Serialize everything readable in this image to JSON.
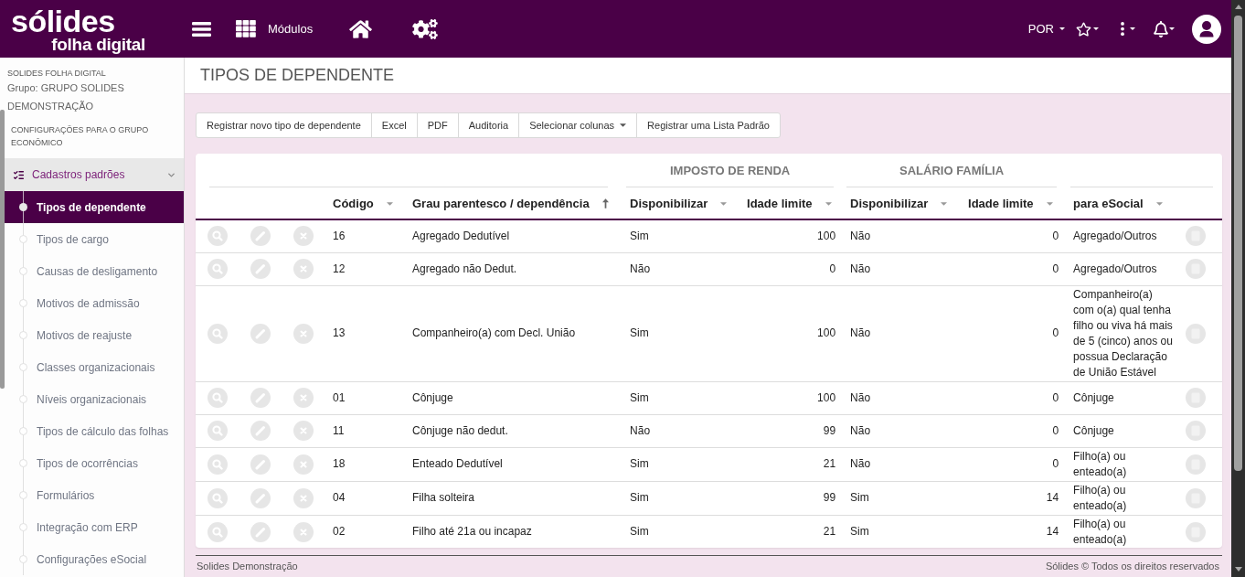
{
  "header": {
    "logo": {
      "brand": "sólides",
      "product": "folha digital"
    },
    "modules_label": "Módulos",
    "language": "POR"
  },
  "sidebar": {
    "app_name": "SOLIDES FOLHA DIGITAL",
    "group": "Grupo: GRUPO SOLIDES DEMONSTRAÇÃO",
    "section_link": "CONFIGURAÇÕES PARA O GRUPO ECONÔMICO",
    "menu": {
      "label": "Cadastros padrões",
      "expanded": true,
      "children": [
        {
          "label": "Tipos de dependente",
          "selected": true
        },
        {
          "label": "Tipos de cargo",
          "selected": false
        },
        {
          "label": "Causas de desligamento",
          "selected": false
        },
        {
          "label": "Motivos de admissão",
          "selected": false
        },
        {
          "label": "Motivos de reajuste",
          "selected": false
        },
        {
          "label": "Classes organizacionais",
          "selected": false
        },
        {
          "label": "Níveis organizacionais",
          "selected": false
        },
        {
          "label": "Tipos de cálculo das folhas",
          "selected": false
        },
        {
          "label": "Tipos de ocorrências",
          "selected": false
        },
        {
          "label": "Formulários",
          "selected": false
        },
        {
          "label": "Integração com ERP",
          "selected": false
        },
        {
          "label": "Configurações eSocial",
          "selected": false
        }
      ]
    }
  },
  "page": {
    "title": "TIPOS DE DEPENDENTE"
  },
  "toolbar": [
    {
      "label": "Registrar novo tipo de dependente",
      "dropdown": false
    },
    {
      "label": "Excel",
      "dropdown": false
    },
    {
      "label": "PDF",
      "dropdown": false
    },
    {
      "label": "Auditoria",
      "dropdown": false
    },
    {
      "label": "Selecionar colunas",
      "dropdown": true
    },
    {
      "label": "Registrar uma Lista Padrão",
      "dropdown": false
    }
  ],
  "table": {
    "header": [
      {
        "kind": "column",
        "label": "Código",
        "sorted": false
      },
      {
        "kind": "column",
        "label": "Grau parentesco / dependência",
        "sorted": true
      },
      {
        "kind": "group",
        "label": "IMPOSTO DE RENDA",
        "columns": [
          {
            "label": "Disponibilizar",
            "sorted": false
          },
          {
            "label": "Idade limite",
            "sorted": false
          }
        ]
      },
      {
        "kind": "group",
        "label": "SALÁRIO FAMÍLIA",
        "columns": [
          {
            "label": "Disponibilizar",
            "sorted": false
          },
          {
            "label": "Idade limite",
            "sorted": false
          }
        ]
      },
      {
        "kind": "column",
        "label": "para eSocial",
        "sorted": false
      }
    ],
    "rows": [
      {
        "cells": [
          "16",
          "Agregado Dedutível",
          "Sim",
          "100",
          "Não",
          "0",
          "Agregado/Outros"
        ]
      },
      {
        "cells": [
          "12",
          "Agregado não Dedut.",
          "Não",
          "0",
          "Não",
          "0",
          "Agregado/Outros"
        ]
      },
      {
        "cells": [
          "13",
          "Companheiro(a) com Decl. União",
          "Sim",
          "100",
          "Não",
          "0",
          "Companheiro(a) com o(a) qual tenha filho ou viva há mais de 5 (cinco) anos ou possua Declaração de União Estável"
        ]
      },
      {
        "cells": [
          "01",
          "Cônjuge",
          "Sim",
          "100",
          "Não",
          "0",
          "Cônjuge"
        ]
      },
      {
        "cells": [
          "11",
          "Cônjuge não dedut.",
          "Não",
          "99",
          "Não",
          "0",
          "Cônjuge"
        ]
      },
      {
        "cells": [
          "18",
          "Enteado Dedutível",
          "Sim",
          "21",
          "Não",
          "0",
          "Filho(a) ou enteado(a)"
        ]
      },
      {
        "cells": [
          "04",
          "Filha solteira",
          "Sim",
          "99",
          "Sim",
          "14",
          "Filho(a) ou enteado(a)"
        ]
      },
      {
        "cells": [
          "02",
          "Filho até 21a ou incapaz",
          "Sim",
          "21",
          "Sim",
          "14",
          "Filho(a) ou enteado(a)"
        ]
      }
    ]
  },
  "footer": {
    "left": "Solides Demonstração",
    "right": "Sólides © Todos os direitos reservados"
  }
}
